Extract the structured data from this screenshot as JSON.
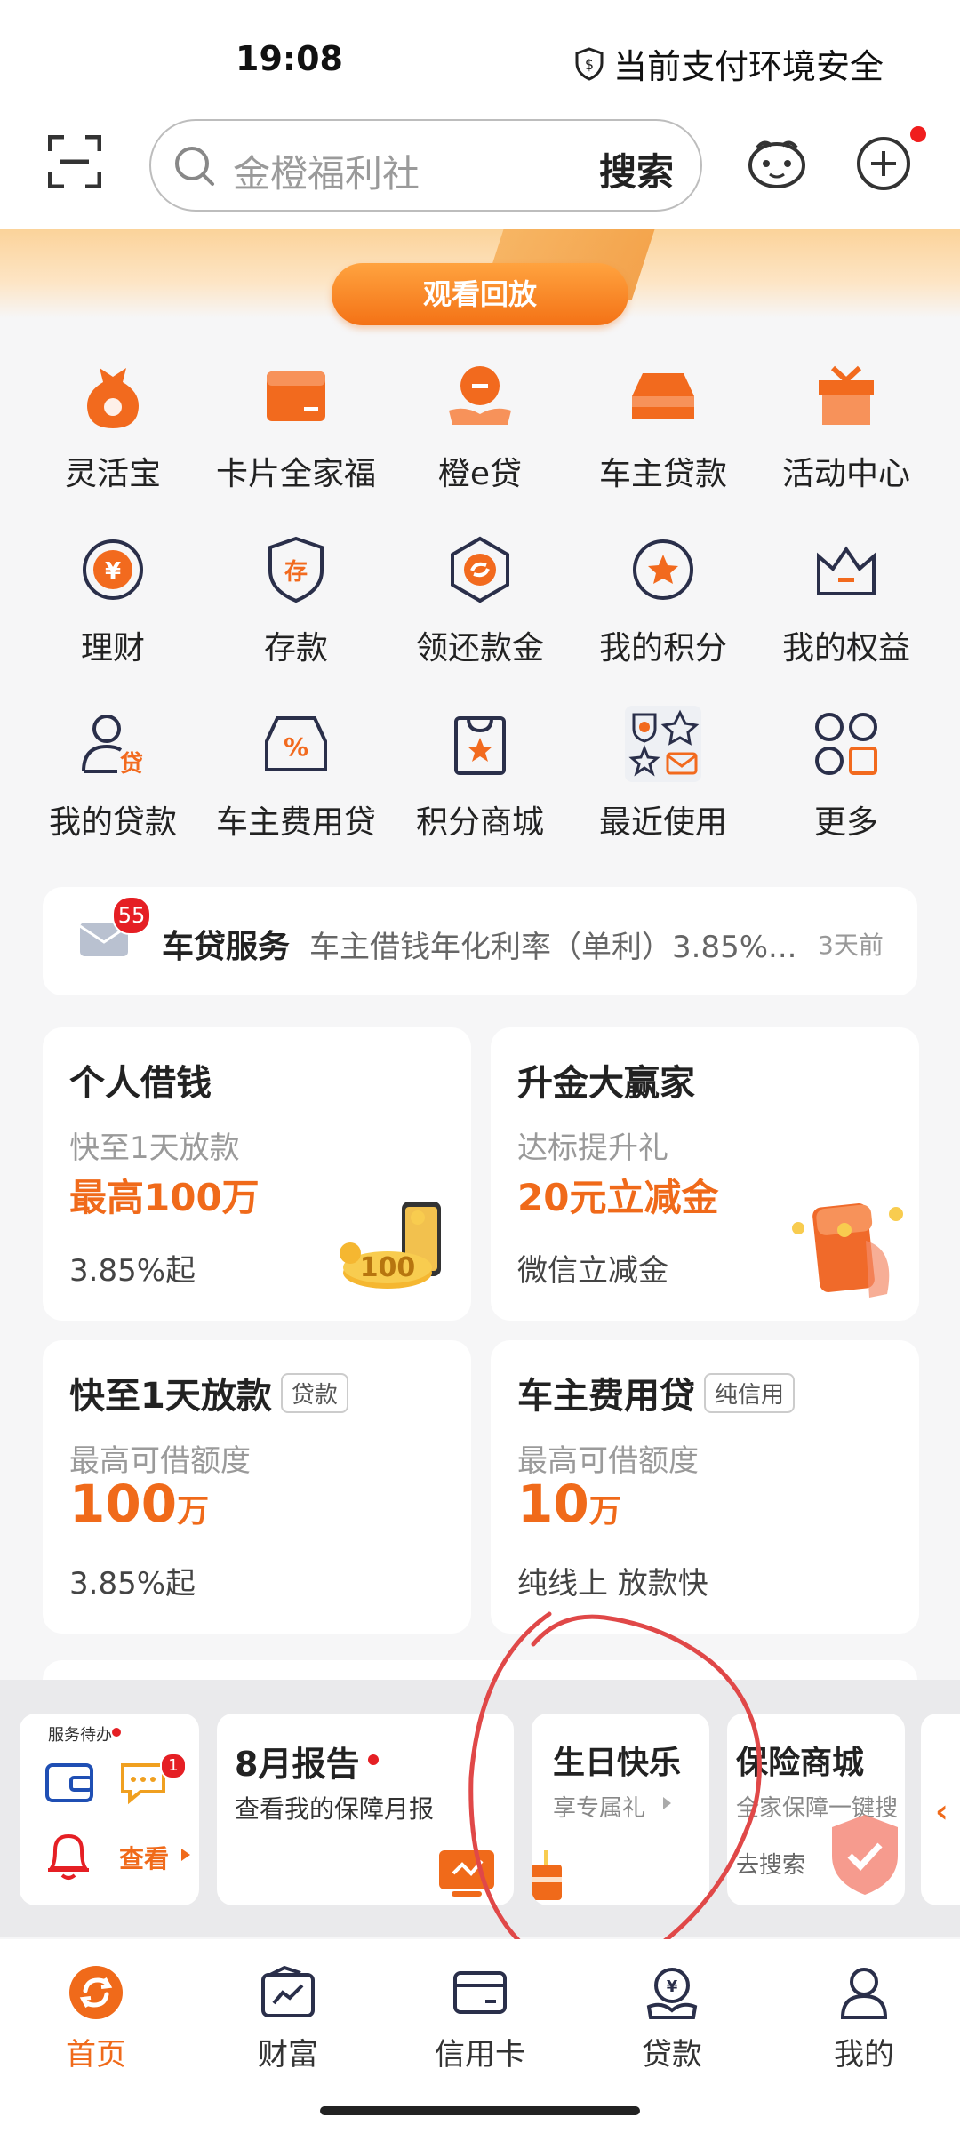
{
  "status_bar": {
    "time": "19:08",
    "security": "当前支付环境安全"
  },
  "header": {
    "search_placeholder": "金橙福利社",
    "search_button": "搜索"
  },
  "banner": {
    "replay_button": "观看回放"
  },
  "grid": [
    {
      "label": "灵活宝",
      "icon": "money-bag-icon"
    },
    {
      "label": "卡片全家福",
      "icon": "card-wallet-icon"
    },
    {
      "label": "橙e贷",
      "icon": "hand-coin-icon"
    },
    {
      "label": "车主贷款",
      "icon": "car-icon"
    },
    {
      "label": "活动中心",
      "icon": "gift-icon"
    },
    {
      "label": "理财",
      "icon": "yuan-icon"
    },
    {
      "label": "存款",
      "icon": "deposit-shield-icon"
    },
    {
      "label": "领还款金",
      "icon": "refund-hexagon-icon"
    },
    {
      "label": "我的积分",
      "icon": "star-coin-icon"
    },
    {
      "label": "我的权益",
      "icon": "crown-icon"
    },
    {
      "label": "我的贷款",
      "icon": "user-loan-icon"
    },
    {
      "label": "车主费用贷",
      "icon": "car-percent-icon"
    },
    {
      "label": "积分商城",
      "icon": "shopping-bag-icon"
    },
    {
      "label": "最近使用",
      "icon": "recent-apps-icon"
    },
    {
      "label": "更多",
      "icon": "more-grid-icon"
    }
  ],
  "message": {
    "badge": "55",
    "title": "车贷服务",
    "text": "车主借钱年化利率（单利）3.85%...",
    "time": "3天前"
  },
  "cards": [
    {
      "title": "个人借钱",
      "sub": "快至1天放款",
      "highlight": "最高100万",
      "foot": "3.85%起"
    },
    {
      "title": "升金大赢家",
      "sub": "达标提升礼",
      "highlight": "20元立减金",
      "foot": "微信立减金"
    },
    {
      "title": "快至1天放款",
      "tag": "贷款",
      "sub": "最高可借额度",
      "amount": "100",
      "unit": "万",
      "foot": "3.85%起"
    },
    {
      "title": "车主费用贷",
      "tag": "纯信用",
      "sub": "最高可借额度",
      "amount": "10",
      "unit": "万",
      "foot": "纯线上 放款快"
    }
  ],
  "service_strip": {
    "todo_label": "服务待办",
    "todo_badge": "1",
    "todo_view": "查看",
    "report_title": "8月报告",
    "report_sub": "查看我的保障月报",
    "birthday_title": "生日快乐",
    "birthday_sub": "享专属礼",
    "insurance_title": "保险商城",
    "insurance_sub": "全家保障一键搜",
    "insurance_link": "去搜索"
  },
  "nav": [
    {
      "label": "首页",
      "icon": "home-icon",
      "active": true
    },
    {
      "label": "财富",
      "icon": "wealth-icon",
      "active": false
    },
    {
      "label": "信用卡",
      "icon": "credit-card-icon",
      "active": false
    },
    {
      "label": "贷款",
      "icon": "loan-icon",
      "active": false
    },
    {
      "label": "我的",
      "icon": "profile-icon",
      "active": false
    }
  ],
  "colors": {
    "accent": "#f06a1a",
    "badge": "#e51f24",
    "annotation": "#e04848"
  }
}
